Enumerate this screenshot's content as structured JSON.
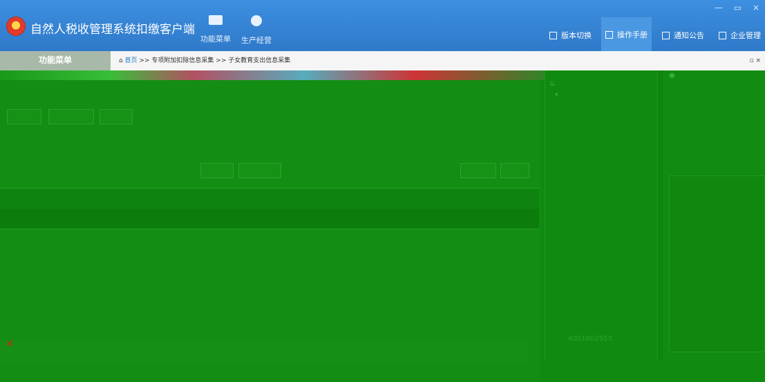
{
  "app": {
    "title": "自然人税收管理系统扣缴客户端",
    "window_controls": "— ▭ ×"
  },
  "top_nav": [
    {
      "label": "功能菜单",
      "icon": "wallet-icon"
    },
    {
      "label": "生产经营",
      "icon": "coins-icon"
    }
  ],
  "top_links": [
    {
      "label": "版本切换",
      "icon": "doc-icon"
    },
    {
      "label": "操作手册",
      "icon": "doc-icon",
      "active": true
    },
    {
      "label": "通知公告",
      "icon": "mail-icon"
    },
    {
      "label": "企业管理",
      "icon": "building-icon"
    }
  ],
  "left_menu": {
    "header": "功能菜单"
  },
  "breadcrumb": {
    "home": "首页",
    "path": ">> 专项附加扣除信息采集 >> 子女教育支出信息采集",
    "controls": "▫ ×"
  },
  "status": {
    "number": "4001002553"
  },
  "colors": {
    "titlebar": "#2f79c9",
    "content_green": "#118a11",
    "accent_red": "#e23b2b"
  }
}
